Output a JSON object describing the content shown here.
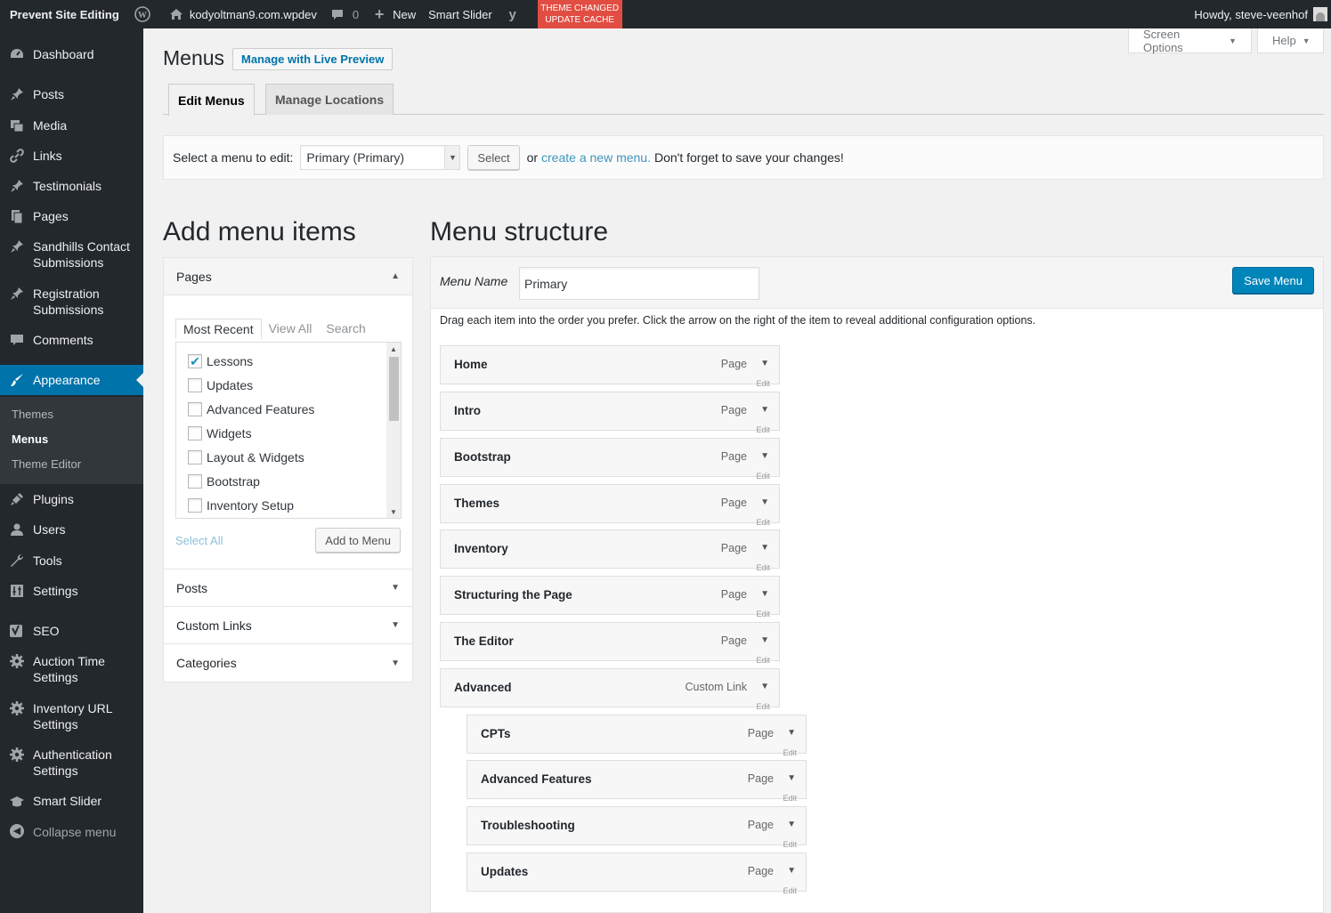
{
  "adminbar": {
    "site_title": "Prevent Site Editing",
    "site_name": "kodyoltman9.com.wpdev",
    "comments_count": "0",
    "new_label": "New",
    "smart_slider": "Smart Slider",
    "alert_line1": "THEME CHANGED",
    "alert_line2": "UPDATE CACHE",
    "howdy": "Howdy, steve-veenhof"
  },
  "sidebar": {
    "items": [
      {
        "label": "Dashboard",
        "icon": "dashboard-icon"
      },
      {
        "label": "Posts",
        "icon": "pin-icon"
      },
      {
        "label": "Media",
        "icon": "media-icon"
      },
      {
        "label": "Links",
        "icon": "link-icon"
      },
      {
        "label": "Testimonials",
        "icon": "pin-icon"
      },
      {
        "label": "Pages",
        "icon": "pages-icon"
      },
      {
        "label": "Sandhills Contact Submissions",
        "icon": "pin-icon"
      },
      {
        "label": "Registration Submissions",
        "icon": "pin-icon"
      },
      {
        "label": "Comments",
        "icon": "comment-icon"
      },
      {
        "label": "Appearance",
        "icon": "brush-icon"
      },
      {
        "label": "Plugins",
        "icon": "plugin-icon"
      },
      {
        "label": "Users",
        "icon": "user-icon"
      },
      {
        "label": "Tools",
        "icon": "wrench-icon"
      },
      {
        "label": "Settings",
        "icon": "settings-icon"
      },
      {
        "label": "SEO",
        "icon": "yoast-icon"
      },
      {
        "label": "Auction Time Settings",
        "icon": "gear-icon"
      },
      {
        "label": "Inventory URL Settings",
        "icon": "gear-icon"
      },
      {
        "label": "Authentication Settings",
        "icon": "gear-icon"
      },
      {
        "label": "Smart Slider",
        "icon": "slider-icon"
      },
      {
        "label": "Collapse menu",
        "icon": "collapse-icon"
      }
    ],
    "submenu": [
      "Themes",
      "Menus",
      "Theme Editor"
    ]
  },
  "screen_options": "Screen Options",
  "help": "Help",
  "page_title": "Menus",
  "live_preview": "Manage with Live Preview",
  "tabs": [
    "Edit Menus",
    "Manage Locations"
  ],
  "manage": {
    "label": "Select a menu to edit:",
    "selected": "Primary (Primary)",
    "select_btn": "Select",
    "or": "or",
    "create_link": "create a new menu.",
    "reminder": "Don't forget to save your changes!"
  },
  "add_items": {
    "heading": "Add menu items",
    "pages_title": "Pages",
    "tabs": [
      "Most Recent",
      "View All",
      "Search"
    ],
    "pages": [
      {
        "label": "Lessons",
        "checked": true
      },
      {
        "label": "Updates",
        "checked": false
      },
      {
        "label": "Advanced Features",
        "checked": false
      },
      {
        "label": "Widgets",
        "checked": false
      },
      {
        "label": "Layout & Widgets",
        "checked": false
      },
      {
        "label": "Bootstrap",
        "checked": false
      },
      {
        "label": "Inventory Setup",
        "checked": false
      }
    ],
    "select_all": "Select All",
    "add_button": "Add to Menu",
    "sections": [
      "Posts",
      "Custom Links",
      "Categories"
    ]
  },
  "structure": {
    "heading": "Menu structure",
    "name_label": "Menu Name",
    "name_value": "Primary",
    "save_button": "Save Menu",
    "instructions": "Drag each item into the order you prefer. Click the arrow on the right of the item to reveal additional configuration options.",
    "edit_peek": "Edit",
    "items": [
      {
        "title": "Home",
        "type": "Page",
        "depth": 0
      },
      {
        "title": "Intro",
        "type": "Page",
        "depth": 0
      },
      {
        "title": "Bootstrap",
        "type": "Page",
        "depth": 0
      },
      {
        "title": "Themes",
        "type": "Page",
        "depth": 0
      },
      {
        "title": "Inventory",
        "type": "Page",
        "depth": 0
      },
      {
        "title": "Structuring the Page",
        "type": "Page",
        "depth": 0
      },
      {
        "title": "The Editor",
        "type": "Page",
        "depth": 0
      },
      {
        "title": "Advanced",
        "type": "Custom Link",
        "depth": 0
      },
      {
        "title": "CPTs",
        "type": "Page",
        "depth": 1
      },
      {
        "title": "Advanced Features",
        "type": "Page",
        "depth": 1
      },
      {
        "title": "Troubleshooting",
        "type": "Page",
        "depth": 1
      },
      {
        "title": "Updates",
        "type": "Page",
        "depth": 1
      }
    ]
  }
}
